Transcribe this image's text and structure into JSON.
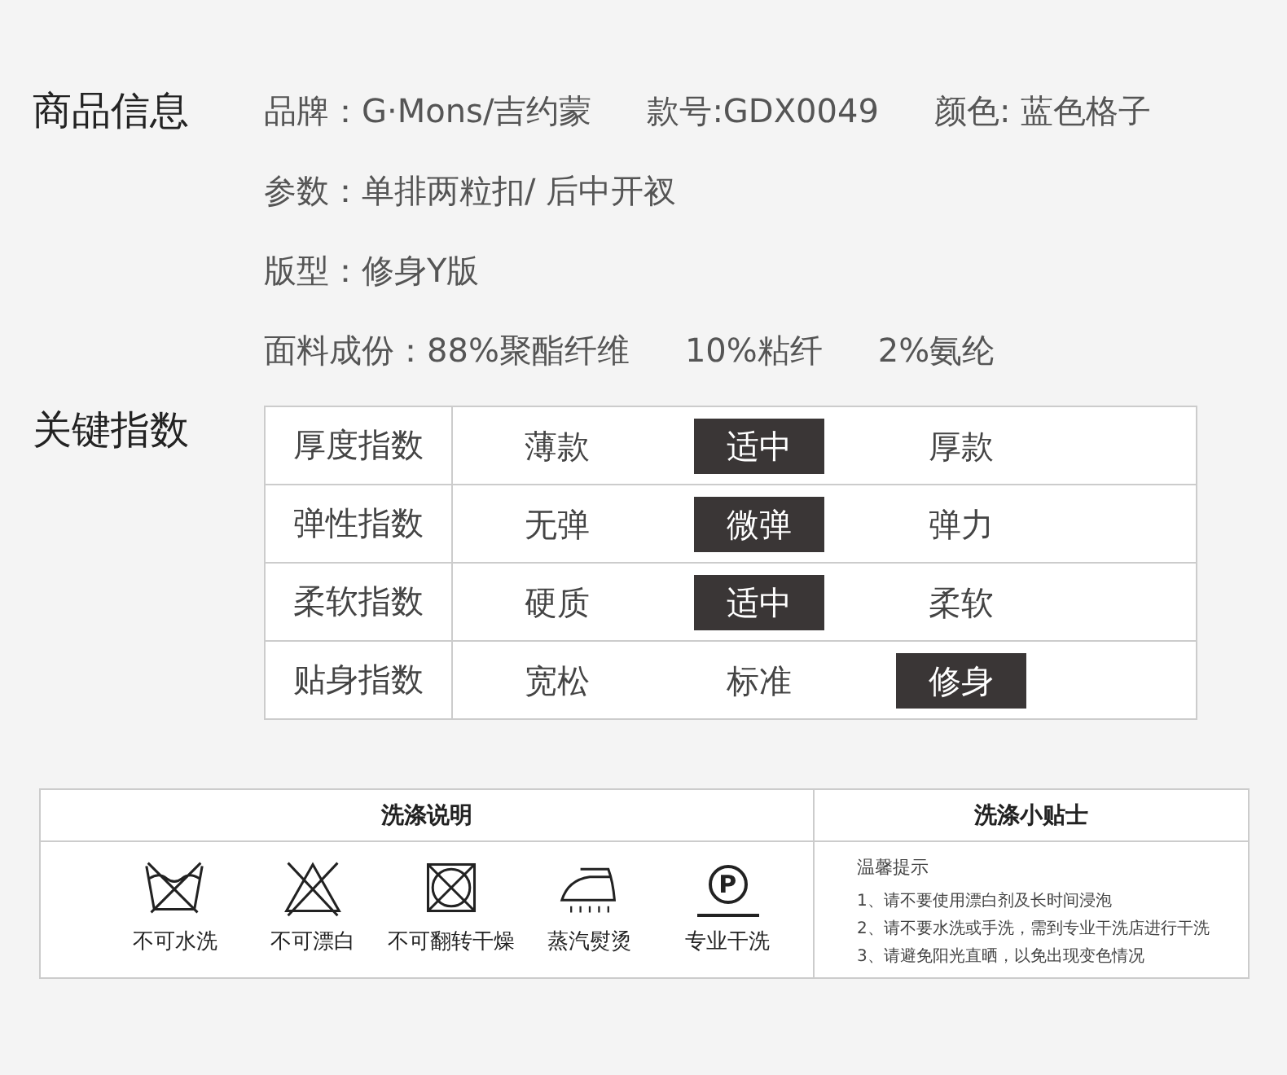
{
  "product_info": {
    "heading": "商品信息",
    "lines": [
      [
        "品牌：G·Mons/吉约蒙",
        "款号:GDX0049",
        "颜色: 蓝色格子"
      ],
      [
        "参数：单排两粒扣/ 后中开衩"
      ],
      [
        "版型：修身Y版"
      ],
      [
        "面料成份：88%聚酯纤维",
        "10%粘纤",
        "2%氨纶"
      ]
    ]
  },
  "key_indices": {
    "heading": "关键指数",
    "rows": [
      {
        "label": "厚度指数",
        "options": [
          {
            "text": "薄款",
            "selected": false
          },
          {
            "text": "适中",
            "selected": true
          },
          {
            "text": "厚款",
            "selected": false
          }
        ]
      },
      {
        "label": "弹性指数",
        "options": [
          {
            "text": "无弹",
            "selected": false
          },
          {
            "text": "微弹",
            "selected": true
          },
          {
            "text": "弹力",
            "selected": false
          }
        ]
      },
      {
        "label": "柔软指数",
        "options": [
          {
            "text": "硬质",
            "selected": false
          },
          {
            "text": "适中",
            "selected": true
          },
          {
            "text": "柔软",
            "selected": false
          }
        ]
      },
      {
        "label": "贴身指数",
        "options": [
          {
            "text": "宽松",
            "selected": false
          },
          {
            "text": "标准",
            "selected": false
          },
          {
            "text": "修身",
            "selected": true
          }
        ]
      }
    ]
  },
  "care": {
    "instructions_title": "洗涤说明",
    "symbols": [
      {
        "kind": "no-wash",
        "label": "不可水洗"
      },
      {
        "kind": "no-bleach",
        "label": "不可漂白"
      },
      {
        "kind": "no-tumble-dry",
        "label": "不可翻转干燥"
      },
      {
        "kind": "steam-iron",
        "label": "蒸汽熨烫"
      },
      {
        "kind": "dry-clean",
        "symbol": "P",
        "label": "专业干洗"
      }
    ],
    "tips_title": "洗涤小贴士",
    "tips_heading": "温馨提示",
    "tips": [
      "1、请不要使用漂白剂及长时间浸泡",
      "2、请不要水洗或手洗，需到专业干洗店进行干洗",
      "3、请避免阳光直晒，以免出现变色情况"
    ]
  }
}
